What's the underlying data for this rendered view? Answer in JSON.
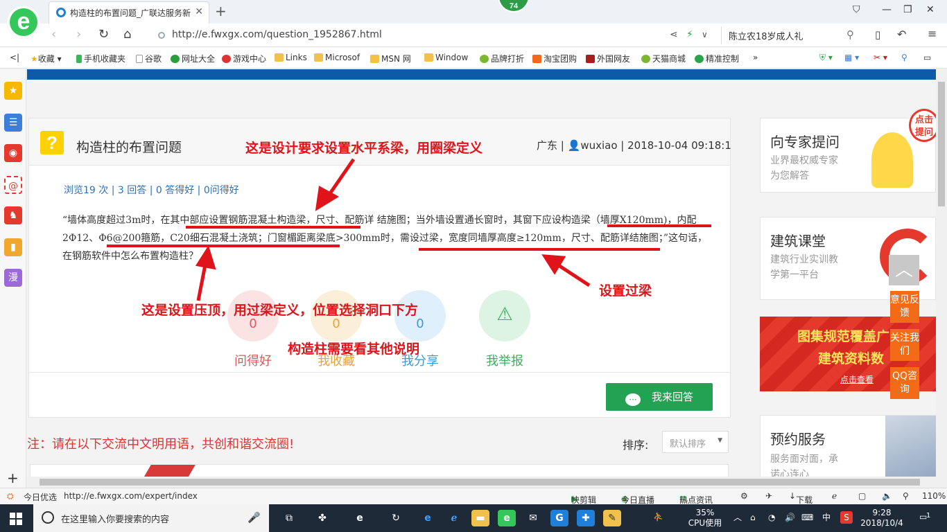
{
  "browser": {
    "tab_title": "构造柱的布置问题_广联达服务新",
    "badge": "74",
    "url": "http://e.fwxgx.com/question_1952867.html",
    "search_query": "陈立农18岁成人礼",
    "bookmarks": [
      "收藏",
      "手机收藏夹",
      "谷歌",
      "网址大全",
      "游戏中心",
      "Links",
      "Microsof",
      "MSN 网",
      "Window",
      "品牌打折",
      "淘宝团购",
      "外国网友",
      "天猫商城",
      "精准控制"
    ],
    "status_bar": {
      "today": "今日优选",
      "hover_url": "http://e.fwxgx.com/expert/index",
      "items": [
        "快剪辑",
        "今日直播",
        "热点资讯",
        "下载"
      ],
      "zoom": "110%"
    }
  },
  "question": {
    "title": "构造柱的布置问题",
    "region": "广东",
    "user": "wuxiao",
    "datetime": "2018-10-04 09:18:1",
    "stats": {
      "views": "浏览19 次",
      "answers": "3 回答",
      "good_answers": "0 答得好",
      "questions_good": "0问得好"
    },
    "body": "“墙体高度超过3m时，在其中部应设置钢筋混凝土构造梁，尺寸、配筋详 结施图；当外墙设置通长窗时，其窗下应设构造梁（墙厚X120mm)，内配 2Φ12、Φ6@200箍筋，C20细石混凝土浇筑；门窗楣距离梁底>300mm时，需设过梁，宽度同墙厚高度≥120mm，尺寸、配筋详结施图；”这句话，在钢筋软件中怎么布置构造柱？",
    "actions": [
      {
        "label": "问得好",
        "count": "0",
        "color": "#e2565c",
        "bg": "#fbe3e4"
      },
      {
        "label": "我收藏",
        "count": "0",
        "color": "#e6a23c",
        "bg": "#fcefd9"
      },
      {
        "label": "我分享",
        "count": "0",
        "color": "#3d9ad9",
        "bg": "#dfeffb"
      },
      {
        "label": "我举报",
        "count": "",
        "color": "#3dae5b",
        "bg": "#ddf3e3"
      }
    ],
    "answer_button": "我来回答"
  },
  "annotations": {
    "top": "这是设计要求设置水平系梁，用圈梁定义",
    "left": "这是设置压顶，用过梁定义，位置选择洞口下方",
    "right": "设置过梁",
    "bottom": "构造柱需要看其他说明"
  },
  "comments": {
    "notice": "注：请在以下交流中文明用语，共创和谐交流圈!",
    "sort_label": "排序:",
    "sort_value": "默认排序"
  },
  "sidebar_right": {
    "expert": {
      "title": "向专家提问",
      "sub1": "业界最权威专家",
      "sub2": "为您解答",
      "bubble": "点击提问"
    },
    "class": {
      "title": "建筑课堂",
      "sub1": "建筑行业实训教",
      "sub2": "学第一平台"
    },
    "promo": {
      "line1": "图集规范覆盖广",
      "line2": "建筑资料数",
      "line3": "点击查看"
    },
    "booking": {
      "title": "预约服务",
      "sub1": "服务面对面，承",
      "sub2": "诺心连心"
    },
    "float_buttons": [
      "意见反馈",
      "关注我们",
      "QQ咨询"
    ]
  },
  "taskbar": {
    "search_placeholder": "在这里输入你要搜索的内容",
    "cpu": "35%",
    "cpu_label": "CPU使用",
    "ime": "中",
    "time": "9:28",
    "date": "2018/10/4",
    "notifications": "1"
  }
}
